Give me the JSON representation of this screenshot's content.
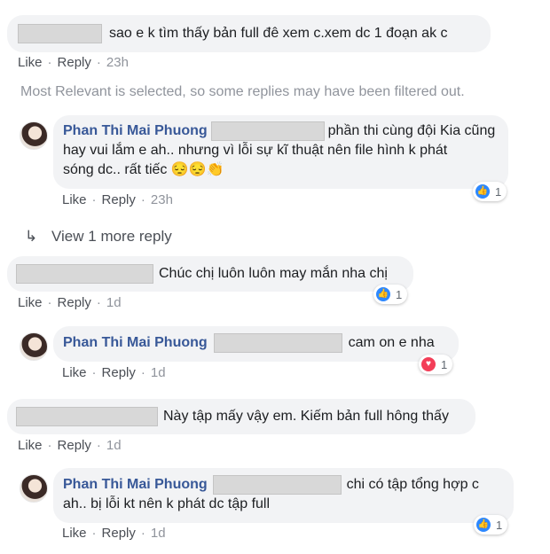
{
  "actions": {
    "like": "Like",
    "reply": "Reply"
  },
  "filter_note": "Most Relevant is selected, so some replies may have been filtered out.",
  "view_more": "View 1 more reply",
  "c1": {
    "text": "sao e k tìm thấy bản full đê xem c.xem dc 1 đoạn ak c",
    "time": "23h"
  },
  "r1": {
    "name": "Phan Thi Mai Phuong",
    "text_l1": "phần thi cùng đội Kia cũng",
    "text_l2": "hay vui lắm e ah.. nhưng vì lỗi sự kĩ thuật nên file hình k phát",
    "text_l3": "sóng dc.. rất tiếc",
    "emoji": "😔😔👏",
    "time": "23h",
    "reaction_count": "1"
  },
  "c2": {
    "text": "Chúc chị luôn luôn may mắn nha chị",
    "time": "1d",
    "reaction_count": "1"
  },
  "r2": {
    "name": "Phan Thi Mai Phuong",
    "text": "cam on e nha",
    "time": "1d",
    "reaction_count": "1"
  },
  "c3": {
    "text": "Này tập mấy vậy em. Kiếm bản full hông thấy",
    "time": "1d"
  },
  "r3": {
    "name": "Phan Thi Mai Phuong",
    "text_l1": "chi có tập tổng hợp c",
    "text_l2": "ah.. bị lỗi kt nên k phát dc tập full",
    "time": "1d",
    "reaction_count": "1"
  }
}
